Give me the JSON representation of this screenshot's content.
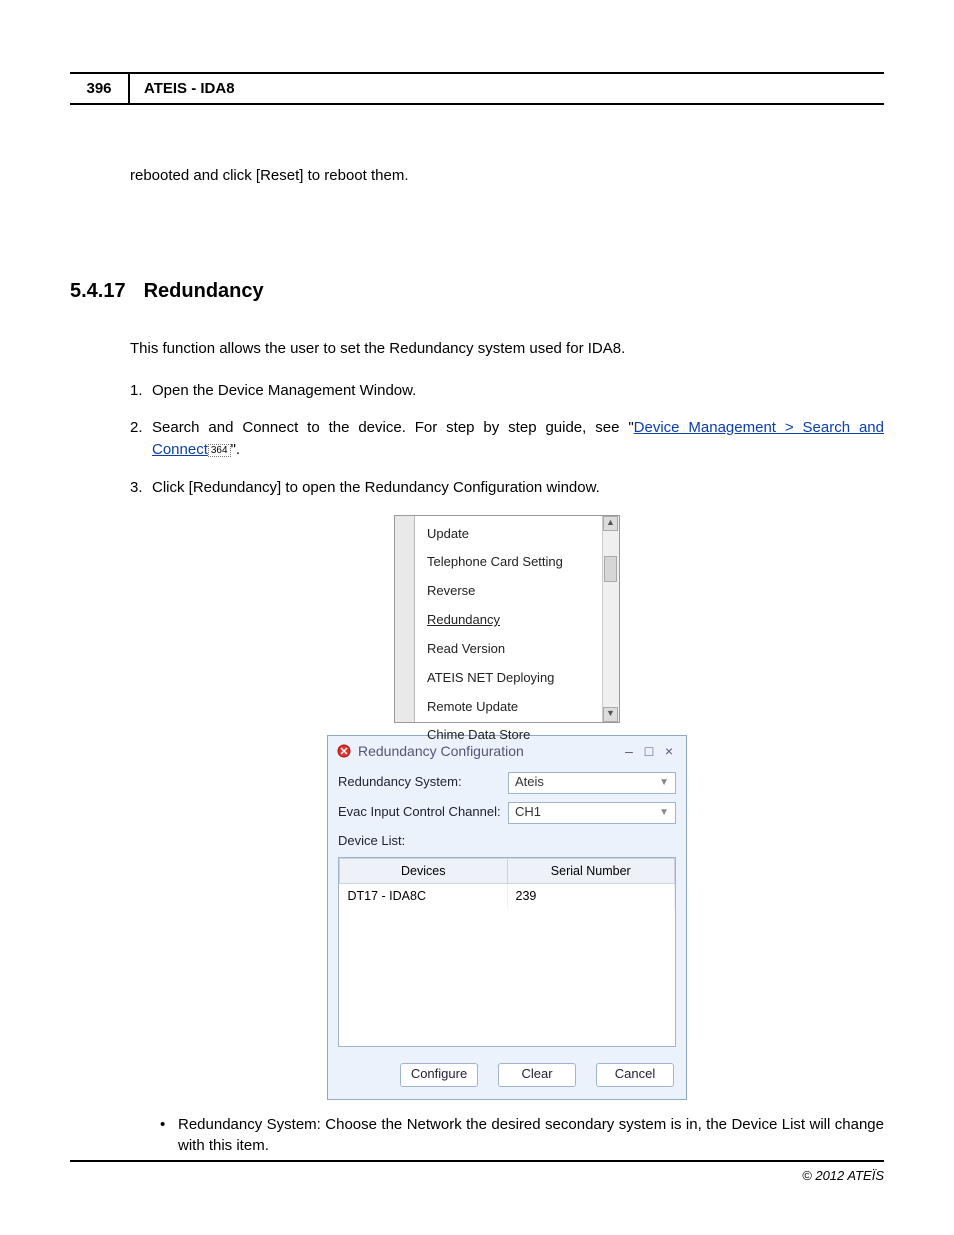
{
  "header": {
    "page_number": "396",
    "doc_title": "ATEIS - IDA8"
  },
  "fragment_text": "rebooted and click [Reset] to reboot them.",
  "section": {
    "number": "5.4.17",
    "title": "Redundancy"
  },
  "intro": "This function allows the user to set the Redundancy system used for IDA8.",
  "steps": {
    "s1": "Open the Device Management Window.",
    "s2_pre": "Search and Connect to the device. For step by step guide, see \"",
    "s2_link": "Device Management > Search and Connect",
    "s2_ref": "364",
    "s2_post": "\".",
    "s3": "Click [Redundancy] to open the Redundancy Configuration window."
  },
  "menu": {
    "items": [
      "Update",
      "Telephone Card Setting",
      "Reverse",
      "Redundancy",
      "Read Version",
      "ATEIS NET Deploying",
      "Remote Update",
      "Chime Data Store"
    ],
    "selected_index": 3
  },
  "dialog": {
    "title": "Redundancy Configuration",
    "window_buttons": {
      "min": "–",
      "max": "□",
      "close": "×"
    },
    "fields": {
      "redundancy_system": {
        "label": "Redundancy System:",
        "value": "Ateis"
      },
      "evac_channel": {
        "label": "Evac Input Control Channel:",
        "value": "CH1"
      }
    },
    "device_list_label": "Device List:",
    "columns": [
      "Devices",
      "Serial Number"
    ],
    "rows": [
      {
        "device": "DT17 - IDA8C",
        "serial": "239"
      }
    ],
    "buttons": {
      "configure": "Configure",
      "clear": "Clear",
      "cancel": "Cancel"
    }
  },
  "bullet": {
    "text": "Redundancy System: Choose the Network the desired secondary system is in, the Device List will change with this item."
  },
  "footer": {
    "copyright": "© 2012 ATEÏS"
  }
}
